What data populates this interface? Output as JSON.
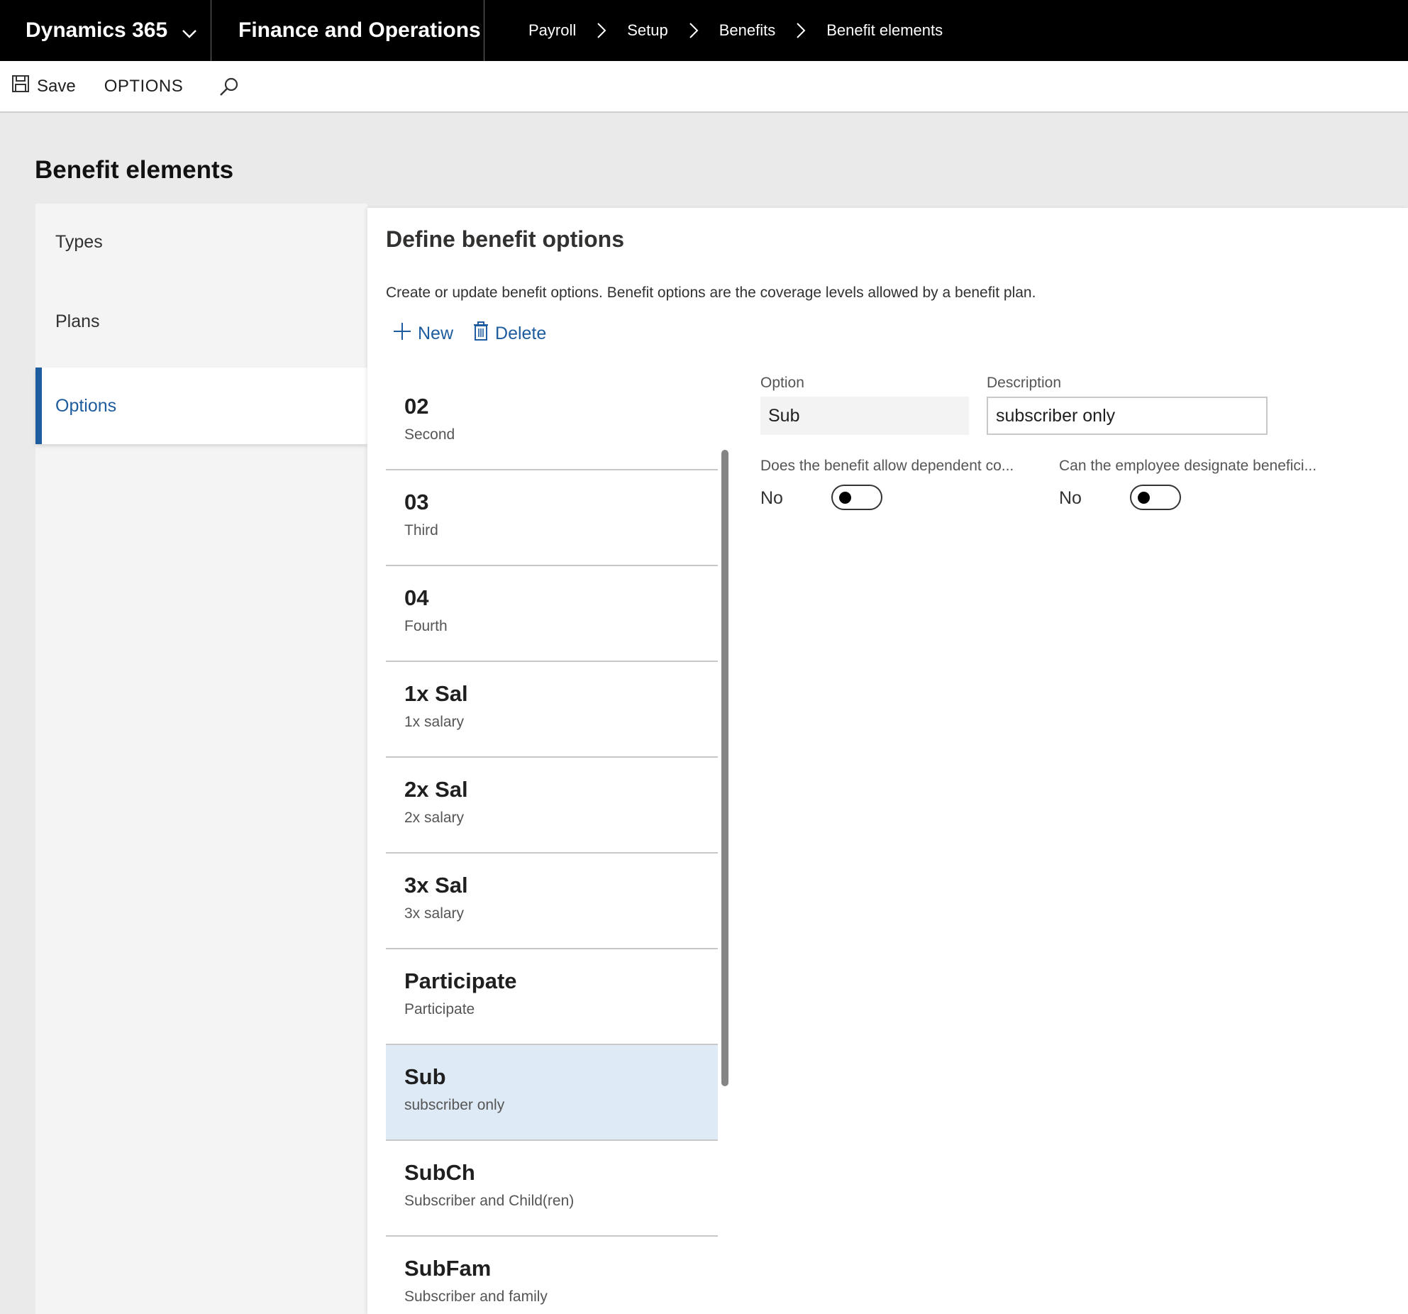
{
  "topbar": {
    "brand": "Dynamics 365",
    "module": "Finance and Operations",
    "breadcrumbs": [
      "Payroll",
      "Setup",
      "Benefits",
      "Benefit elements"
    ]
  },
  "actions": {
    "save": "Save",
    "options": "OPTIONS"
  },
  "page_title": "Benefit elements",
  "sidenav": {
    "items": [
      {
        "label": "Types"
      },
      {
        "label": "Plans"
      },
      {
        "label": "Options",
        "active": true
      }
    ]
  },
  "main": {
    "title": "Define benefit options",
    "description": "Create or update benefit options. Benefit options are the coverage levels allowed by a benefit plan.",
    "toolbar": {
      "new": "New",
      "delete": "Delete"
    },
    "list": [
      {
        "code": "02",
        "desc": "Second"
      },
      {
        "code": "03",
        "desc": "Third"
      },
      {
        "code": "04",
        "desc": "Fourth"
      },
      {
        "code": "1x Sal",
        "desc": "1x salary"
      },
      {
        "code": "2x Sal",
        "desc": "2x salary"
      },
      {
        "code": "3x Sal",
        "desc": "3x salary"
      },
      {
        "code": "Participate",
        "desc": "Participate"
      },
      {
        "code": "Sub",
        "desc": "subscriber only",
        "selected": true
      },
      {
        "code": "SubCh",
        "desc": "Subscriber and Child(ren)"
      },
      {
        "code": "SubFam",
        "desc": "Subscriber and family"
      }
    ],
    "detail": {
      "option_label": "Option",
      "option_value": "Sub",
      "description_label": "Description",
      "description_value": "subscriber only",
      "dependent_label": "Does the benefit allow dependent co...",
      "dependent_value": "No",
      "beneficiary_label": "Can the employee designate benefici...",
      "beneficiary_value": "No"
    }
  },
  "colors": {
    "accent": "#1d5c9e",
    "topbar": "#000000",
    "selected_row": "#deeaf6"
  },
  "icons": {
    "brand_chevron": "chevron-down-icon",
    "breadcrumb_separator": "chevron-right-icon",
    "save": "save-icon",
    "search": "search-icon",
    "new": "plus-icon",
    "delete": "trash-icon"
  }
}
